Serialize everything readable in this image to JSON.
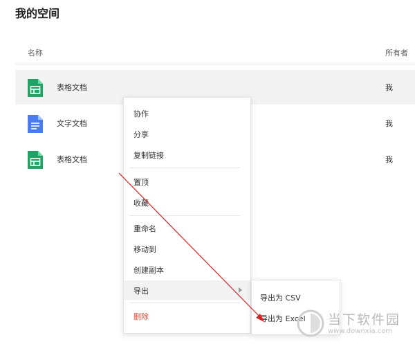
{
  "page": {
    "title": "我的空间"
  },
  "table": {
    "header": {
      "name": "名称",
      "owner": "所有者"
    },
    "rows": [
      {
        "name": "表格文档",
        "owner": "我",
        "icon": "spreadsheet-icon",
        "selected": true
      },
      {
        "name": "文字文档",
        "owner": "我",
        "icon": "document-icon",
        "selected": false
      },
      {
        "name": "表格文档",
        "owner": "我",
        "icon": "spreadsheet-icon",
        "selected": false
      }
    ]
  },
  "context_menu": {
    "items": {
      "collaborate": "协作",
      "share": "分享",
      "copy_link": "复制链接",
      "pin": "置顶",
      "favorite": "收藏",
      "rename": "重命名",
      "move_to": "移动到",
      "duplicate": "创建副本",
      "export": "导出",
      "delete": "删除"
    }
  },
  "export_submenu": {
    "csv": "导出为 CSV",
    "excel": "导出为 Excel"
  },
  "watermark": {
    "text": "当下软件园",
    "url": "www.downxia.com"
  },
  "colors": {
    "spreadsheet": "#21a366",
    "document": "#4a7cf0",
    "danger": "#e84a36",
    "arrow": "#e02020"
  }
}
